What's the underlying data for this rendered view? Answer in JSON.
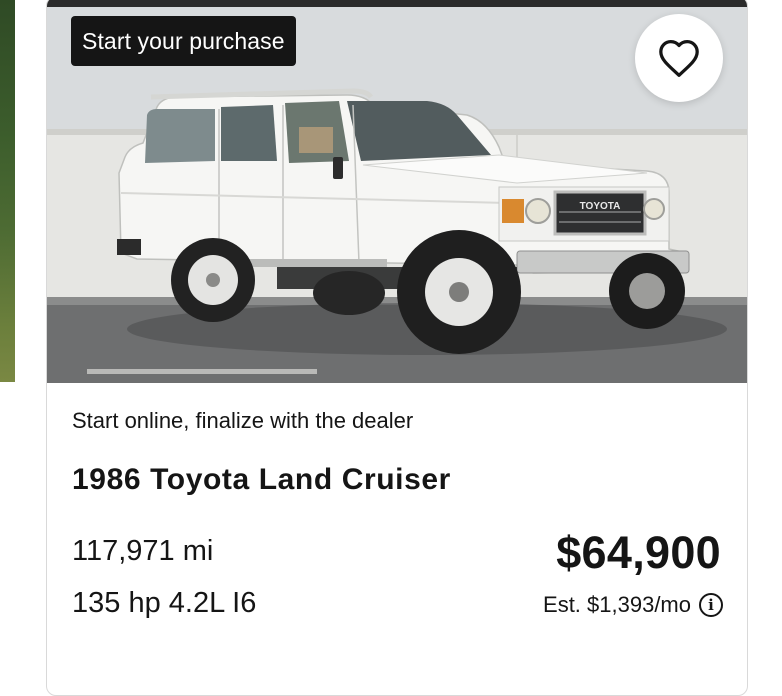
{
  "listing": {
    "badge": "Start your purchase",
    "subtitle": "Start online, finalize with the dealer",
    "title": "1986 Toyota Land Cruiser",
    "mileage": "117,971 mi",
    "engine": "135 hp 4.2L I6",
    "price": "$64,900",
    "monthly": "Est. $1,393/mo",
    "grille_text": "TOYOTA",
    "photo_alt": "White 1986 Toyota Land Cruiser"
  },
  "icons": {
    "favorite": "heart-outline-icon",
    "info": "info-circle-icon"
  },
  "colors": {
    "text": "#151515",
    "badge_bg": "#151515",
    "badge_text": "#ffffff",
    "card_border": "#d9d9d9"
  }
}
